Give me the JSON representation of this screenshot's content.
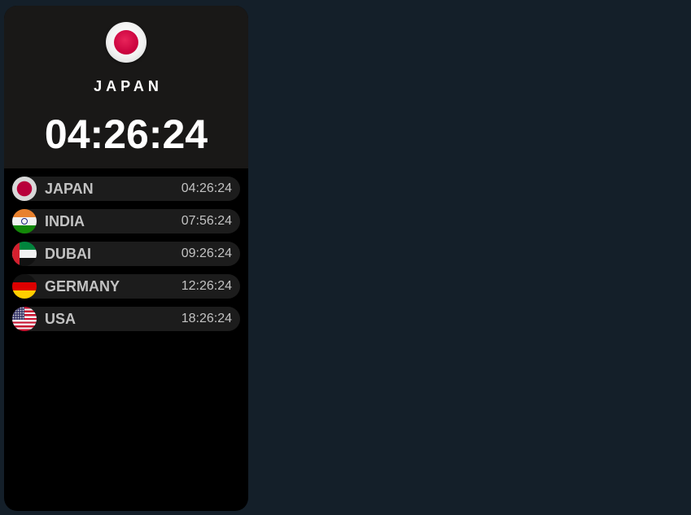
{
  "selected": {
    "city": "JAPAN",
    "time": "04:26:24",
    "flag_icon": "japan-flag-icon"
  },
  "clocks": [
    {
      "label": "JAPAN",
      "time": "04:26:24",
      "flag_icon": "japan-flag-icon"
    },
    {
      "label": "INDIA",
      "time": "07:56:24",
      "flag_icon": "india-flag-icon"
    },
    {
      "label": "DUBAI",
      "time": "09:26:24",
      "flag_icon": "uae-flag-icon"
    },
    {
      "label": "GERMANY",
      "time": "12:26:24",
      "flag_icon": "germany-flag-icon"
    },
    {
      "label": "USA",
      "time": "18:26:24",
      "flag_icon": "usa-flag-icon"
    }
  ],
  "colors": {
    "page_background": "#141f29",
    "header_background": "#191817",
    "list_background": "#000000",
    "row_background": "#1c1c1c",
    "text_primary": "#ffffff",
    "text_secondary": "#c2c2c2",
    "japan_red": "#c8003c"
  }
}
